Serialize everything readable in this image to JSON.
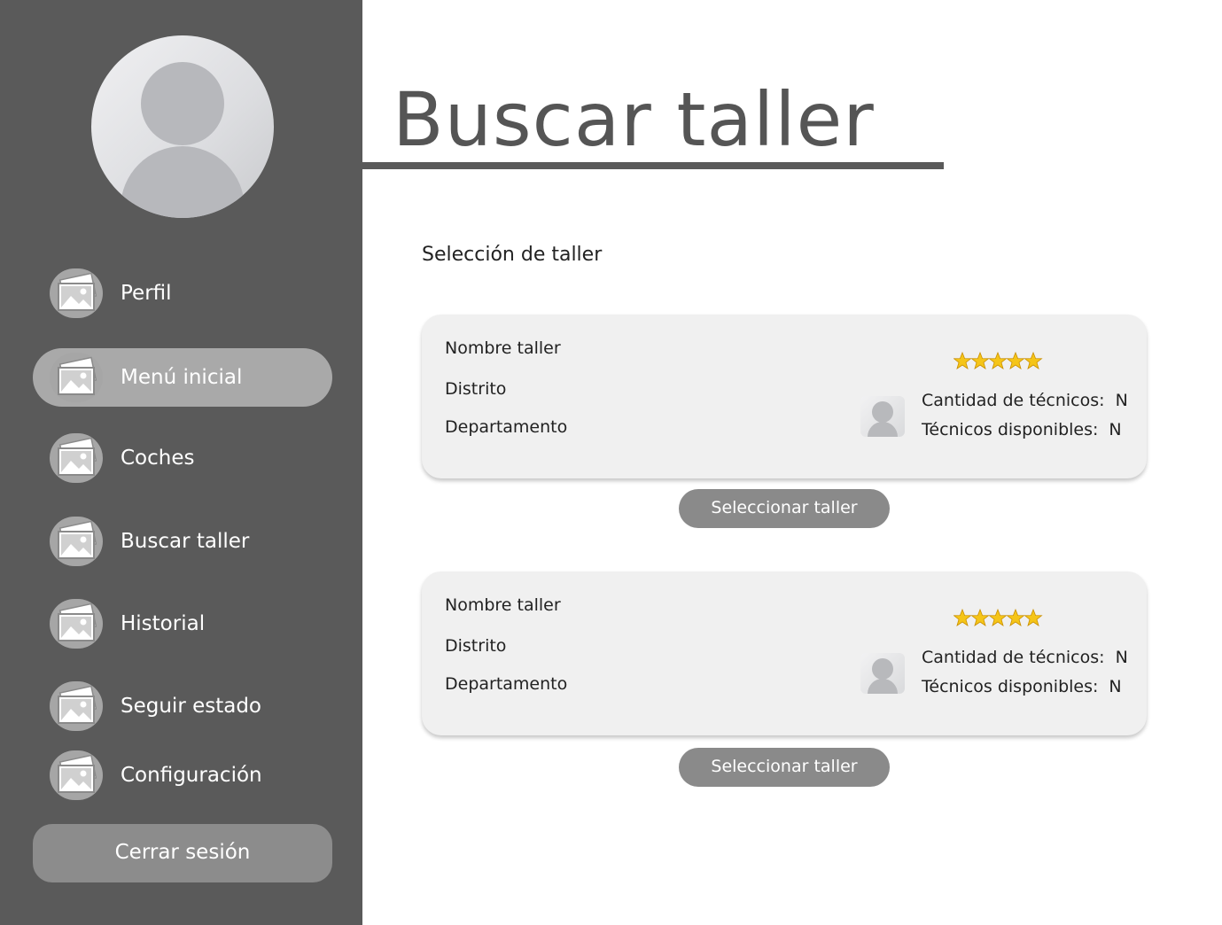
{
  "page": {
    "title": "Buscar taller",
    "section_label": "Selección de taller"
  },
  "sidebar": {
    "items": [
      {
        "label": "Perfil",
        "icon": "image-icon",
        "active": false
      },
      {
        "label": "Menú inicial",
        "icon": "image-icon",
        "active": true
      },
      {
        "label": "Coches",
        "icon": "image-icon",
        "active": false
      },
      {
        "label": "Buscar taller",
        "icon": "image-icon",
        "active": false
      },
      {
        "label": "Historial",
        "icon": "image-icon",
        "active": false
      },
      {
        "label": "Seguir estado",
        "icon": "image-icon",
        "active": false
      },
      {
        "label": "Configuración",
        "icon": "image-icon",
        "active": false
      }
    ],
    "logout_label": "Cerrar sesión"
  },
  "workshops": [
    {
      "name": "Nombre taller",
      "district": "Distrito",
      "department": "Departamento",
      "rating_stars": 5,
      "tech_count_label": "Cantidad de técnicos:",
      "tech_count_value": "N",
      "tech_available_label": "Técnicos disponibles:",
      "tech_available_value": "N",
      "button_label": "Seleccionar taller"
    },
    {
      "name": "Nombre taller",
      "district": "Distrito",
      "department": "Departamento",
      "rating_stars": 5,
      "tech_count_label": "Cantidad de técnicos:",
      "tech_count_value": "N",
      "tech_available_label": "Técnicos disponibles:",
      "tech_available_value": "N",
      "button_label": "Seleccionar taller"
    }
  ],
  "colors": {
    "sidebar_bg": "#5a5a5a",
    "active_item_bg": "#a9a9a9",
    "button_bg": "#8a8a8a",
    "card_bg": "#f0f0f0",
    "title_color": "#555555",
    "star_color": "#f5c518"
  }
}
